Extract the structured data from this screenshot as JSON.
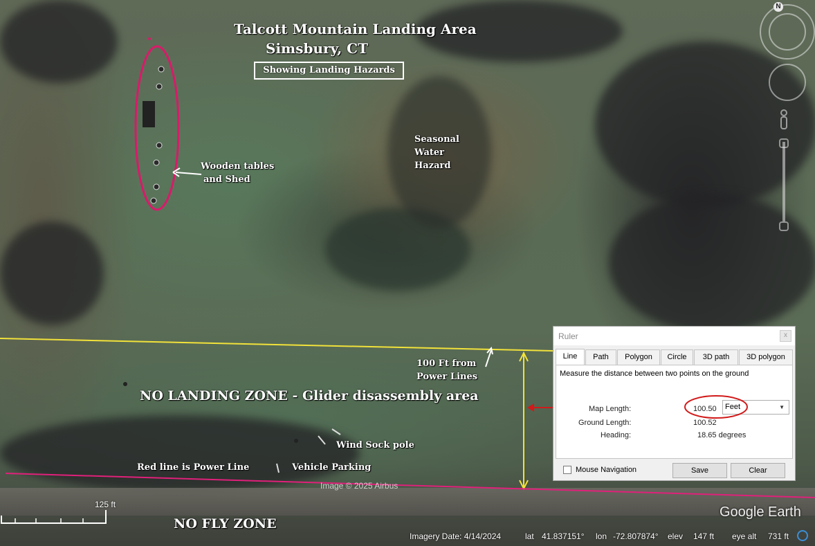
{
  "map": {
    "title_line1": "Talcott Mountain Landing Area",
    "title_line2": "Simsbury, CT",
    "subtitle": "Showing Landing Hazards",
    "labels": {
      "tables": "Wooden tables",
      "shed": "and Shed",
      "water1": "Seasonal",
      "water2": "Water",
      "water3": "Hazard",
      "distance1": "100 Ft from",
      "distance2": "Power Lines",
      "no_landing": "NO LANDING ZONE - Glider disassembly area",
      "wind_sock": "Wind Sock pole",
      "power_line": "Red line is Power Line",
      "parking": "Vehicle Parking",
      "no_fly": "NO FLY ZONE"
    },
    "copyright": "Image © 2025 Airbus",
    "scale_label": "125 ft",
    "logo": "Google Earth",
    "colors": {
      "power_line": "#e0207a",
      "boundary_line": "#f2e23a",
      "callout_red": "#d11a1a",
      "hazard_ellipse": "#d81b6a"
    }
  },
  "navigation": {
    "north_label": "N",
    "compass_icon": "compass-ring",
    "look_icon": "look-joystick",
    "zoom_icon": "zoom-slider",
    "pegman_icon": "street-view-pegman"
  },
  "ruler": {
    "title": "Ruler",
    "close": "x",
    "tabs": [
      "Line",
      "Path",
      "Polygon",
      "Circle",
      "3D path",
      "3D polygon"
    ],
    "active_tab": "Line",
    "description": "Measure the distance between two points on the ground",
    "map_length_label": "Map Length:",
    "map_length_value": "100.50",
    "unit": "Feet",
    "ground_length_label": "Ground Length:",
    "ground_length_value": "100.52",
    "heading_label": "Heading:",
    "heading_value": "18.65 degrees",
    "mouse_nav_label": "Mouse Navigation",
    "save_label": "Save",
    "clear_label": "Clear"
  },
  "status": {
    "imagery_date": "Imagery Date: 4/14/2024",
    "lat_label": "lat",
    "lat_value": "41.837151°",
    "lon_label": "lon",
    "lon_value": "-72.807874°",
    "elev_label": "elev",
    "elev_value": "147 ft",
    "eye_alt_label": "eye alt",
    "eye_alt_value": "731 ft"
  }
}
